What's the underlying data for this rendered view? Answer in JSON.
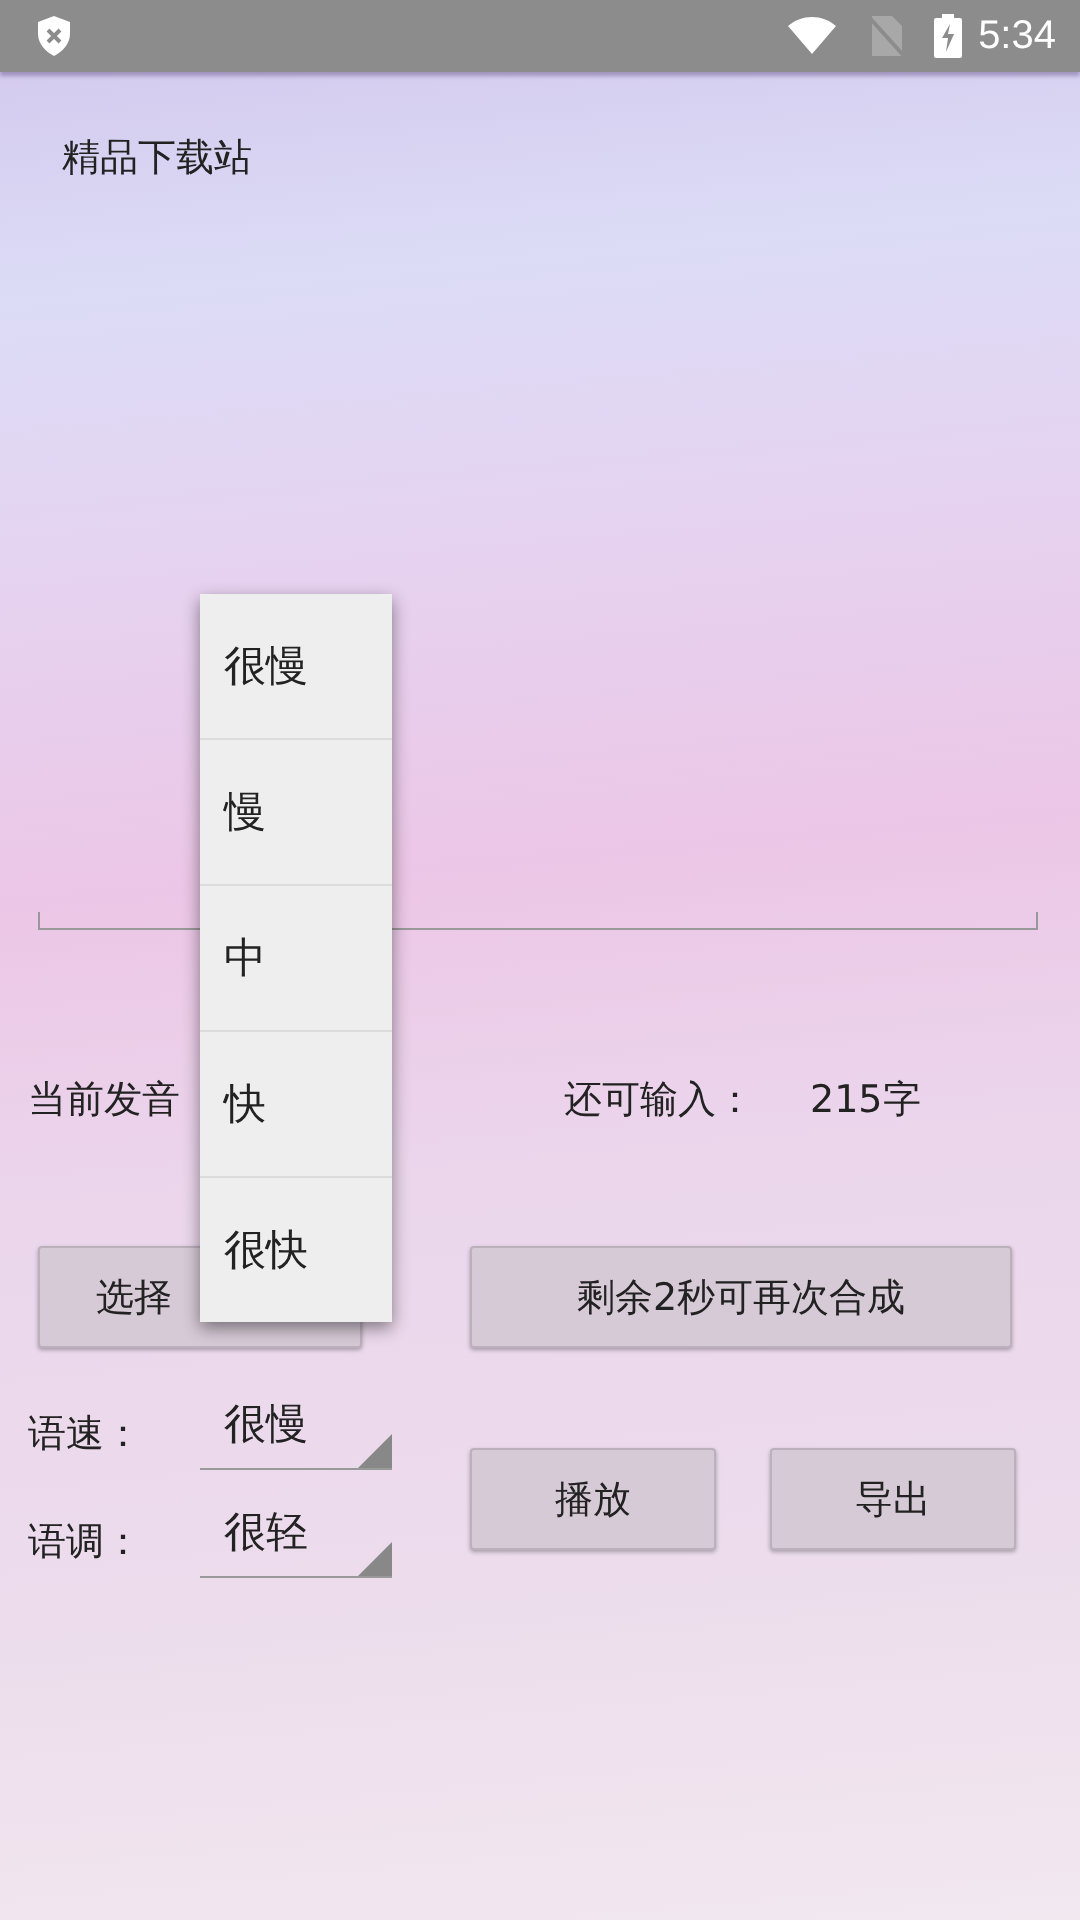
{
  "status_bar": {
    "time": "5:34"
  },
  "app_title": "精品下载站",
  "pronunciation_label": "当前发音",
  "remaining_label": "还可输入：",
  "remaining_count": "215字",
  "select_voice_button": "选择",
  "synthesize_button": "剩余2秒可再次合成",
  "speed": {
    "label": "语速：",
    "value": "很慢"
  },
  "pitch": {
    "label": "语调：",
    "value": "很轻"
  },
  "play_button": "播放",
  "export_button": "导出",
  "speed_menu": [
    {
      "label": "很慢"
    },
    {
      "label": "慢"
    },
    {
      "label": "中"
    },
    {
      "label": "快"
    },
    {
      "label": "很快"
    }
  ]
}
